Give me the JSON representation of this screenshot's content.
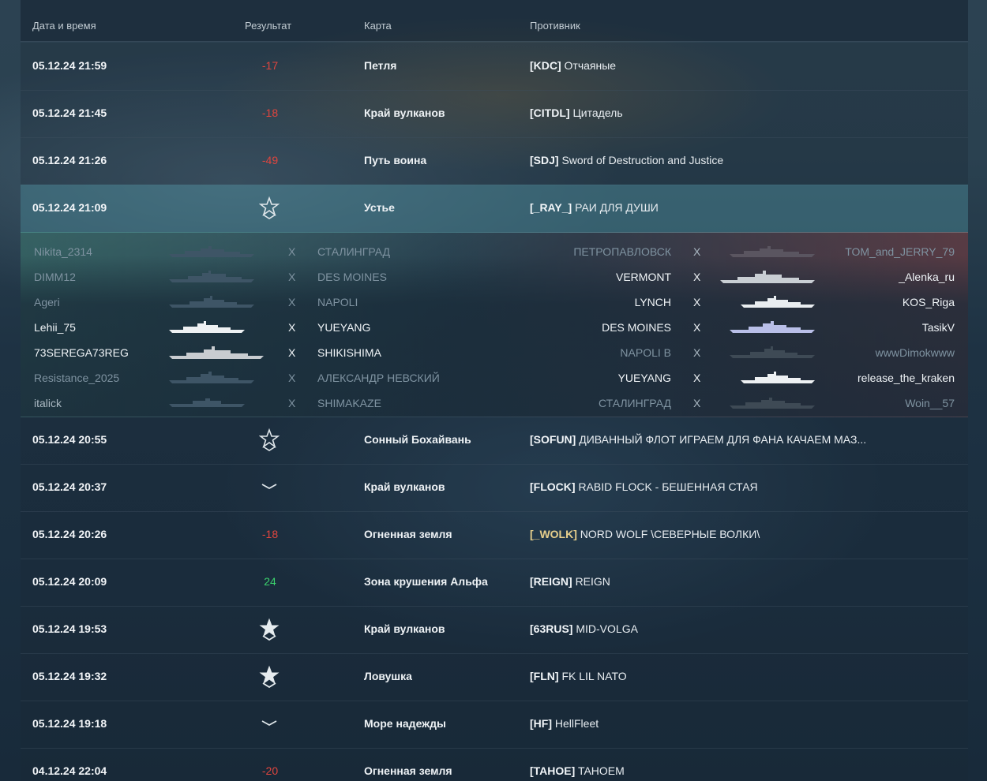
{
  "header": {
    "date": "Дата и время",
    "result": "Результат",
    "map": "Карта",
    "opponent": "Противник"
  },
  "rows": [
    {
      "date": "05.12.24 21:59",
      "result": "-17",
      "map": "Петля",
      "tag": "[KDC]",
      "clan": "Отчаяные"
    },
    {
      "date": "05.12.24 21:45",
      "result": "-18",
      "map": "Край вулканов",
      "tag": "[CITDL]",
      "clan": "Цитадель"
    },
    {
      "date": "05.12.24 21:26",
      "result": "-49",
      "map": "Путь воина",
      "tag": "[SDJ]",
      "clan": "Sword of Destruction and Justice"
    },
    {
      "date": "05.12.24 21:09",
      "result_icon": "star-outline-icon",
      "map": "Устье",
      "tag": "[_RAY_]",
      "clan": "РАИ ДЛЯ ДУШИ",
      "expanded": true
    },
    {
      "date": "05.12.24 20:55",
      "result_icon": "star-outline-icon",
      "map": "Сонный Бохайвань",
      "tag": "[SOFUN]",
      "clan": "ДИВАННЫЙ ФЛОТ ИГРАЕМ ДЛЯ ФАНА КАЧАЕМ МАЗ..."
    },
    {
      "date": "05.12.24 20:37",
      "result_icon": "chevron-icon",
      "map": "Край вулканов",
      "tag": "[FLOCK]",
      "clan": "RABID FLOCK - БЕШЕННАЯ СТАЯ"
    },
    {
      "date": "05.12.24 20:26",
      "result": "-18",
      "map": "Огненная земля",
      "tag": "[_WOLK]",
      "clan": "NORD WOLF \\СЕВЕРНЫЕ ВОЛКИ\\",
      "tag_color": "#e7cf8c"
    },
    {
      "date": "05.12.24 20:09",
      "result": "24",
      "map": "Зона крушения Альфа",
      "tag": "[REIGN]",
      "clan": "REIGN"
    },
    {
      "date": "05.12.24 19:53",
      "result_icon": "star-filled-icon",
      "map": "Край вулканов",
      "tag": "[63RUS]",
      "clan": "MID-VOLGA"
    },
    {
      "date": "05.12.24 19:32",
      "result_icon": "star-filled-icon",
      "map": "Ловушка",
      "tag": "[FLN]",
      "clan": "FK LIL NATO"
    },
    {
      "date": "05.12.24 19:18",
      "result_icon": "chevron-icon",
      "map": "Море надежды",
      "tag": "[HF]",
      "clan": "HellFleet"
    },
    {
      "date": "04.12.24 22:04",
      "result": "-20",
      "map": "Огненная земля",
      "tag": "[TAHOE]",
      "clan": "TAHOEM"
    }
  ],
  "detail": {
    "x": "X",
    "players": [
      {
        "left_name": "Nikita_2314",
        "left_ship": "СТАЛИНГРАД",
        "left_alive": false,
        "right_ship": "ПЕТРОПАВЛОВСК",
        "right_name": "TOM_and_JERRY_79",
        "right_alive": false
      },
      {
        "left_name": "DIMM12",
        "left_ship": "DES MOINES",
        "left_alive": false,
        "right_ship": "VERMONT",
        "right_name": "_Alenka_ru",
        "right_alive": true
      },
      {
        "left_name": "Ageri",
        "left_ship": "NAPOLI",
        "left_alive": false,
        "right_ship": "LYNCH",
        "right_name": "KOS_Riga",
        "right_alive": true
      },
      {
        "left_name": "Lehii_75",
        "left_ship": "YUEYANG",
        "left_alive": true,
        "right_ship": "DES MOINES",
        "right_name": "TasikV",
        "right_alive": true
      },
      {
        "left_name": "73SEREGA73REG",
        "left_ship": "SHIKISHIMA",
        "left_alive": true,
        "right_ship": "NAPOLI B",
        "right_name": "wwwDimokwww",
        "right_alive": false
      },
      {
        "left_name": "Resistance_2025",
        "left_ship": "АЛЕКСАНДР НЕВСКИЙ",
        "left_alive": false,
        "right_ship": "YUEYANG",
        "right_name": "release_the_kraken",
        "right_alive": true
      },
      {
        "left_name": "italick",
        "left_ship": "SHIMAKAZE",
        "left_alive": false,
        "right_ship": "СТАЛИНГРАД",
        "right_name": "Woin__57",
        "right_alive": false
      }
    ]
  },
  "colors": {
    "negative": "#e0453e",
    "positive": "#3bd26d",
    "selected_row": "#467d8c"
  }
}
